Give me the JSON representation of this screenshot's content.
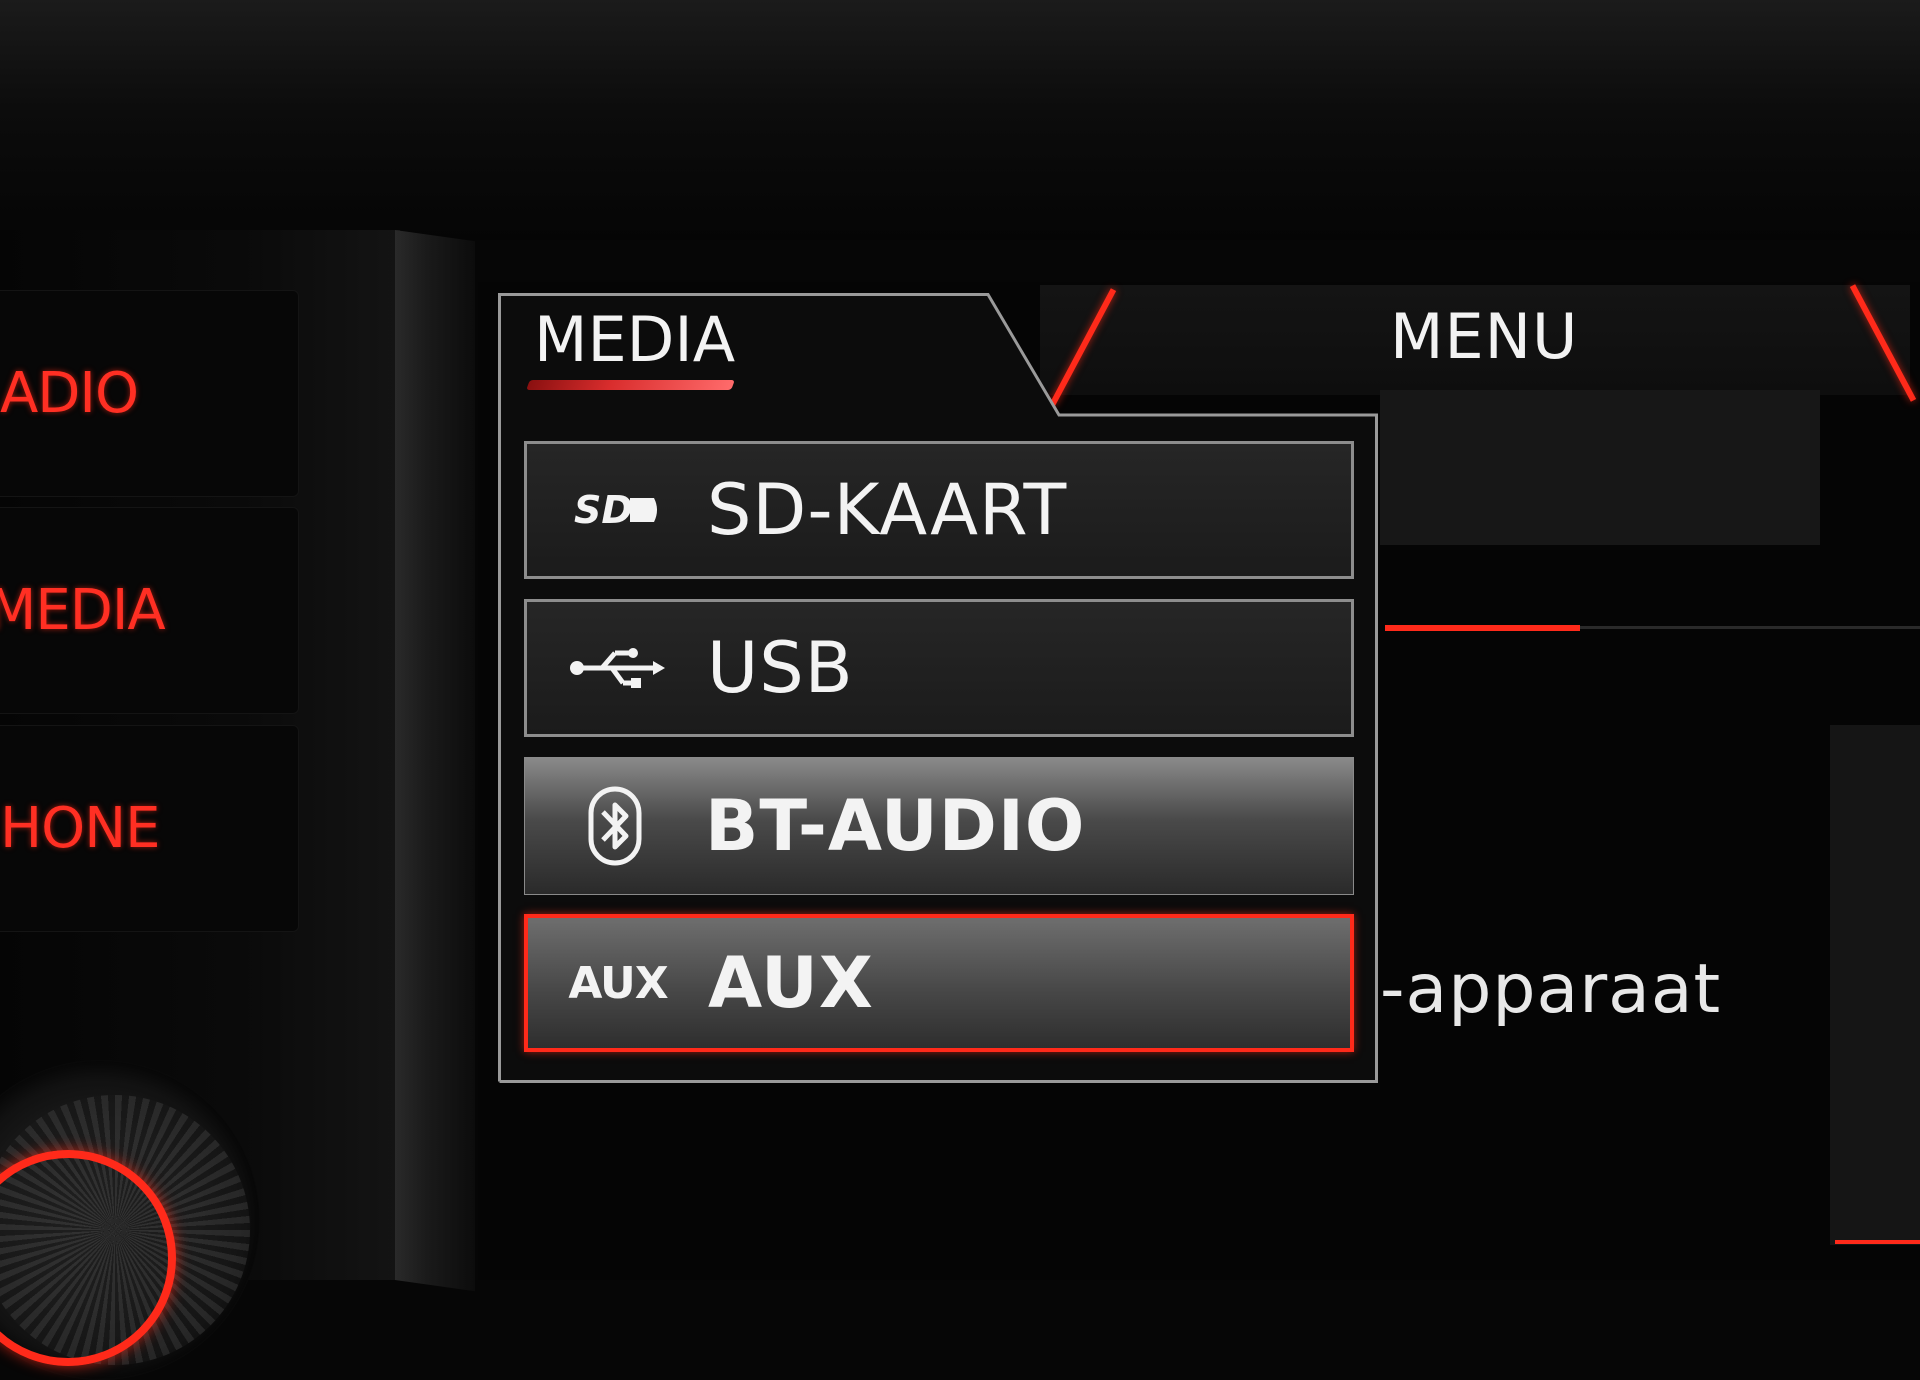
{
  "hardware_buttons": [
    {
      "label": "ADIO"
    },
    {
      "label": "MEDIA"
    },
    {
      "label": "HONE"
    }
  ],
  "header": {
    "menu_tab_label": "MENU"
  },
  "background": {
    "text": "-apparaat"
  },
  "popup": {
    "title": "MEDIA",
    "items": [
      {
        "label": "SD-KAART",
        "icon": "sd-card-icon",
        "state": "normal"
      },
      {
        "label": "USB",
        "icon": "usb-icon",
        "state": "normal"
      },
      {
        "label": "BT-AUDIO",
        "icon": "bluetooth-icon",
        "state": "highlighted"
      },
      {
        "label": "AUX",
        "icon": "aux-icon",
        "icon_text": "AUX",
        "state": "selected"
      }
    ]
  },
  "colors": {
    "accent_red": "#ff2a1a",
    "text_white": "#f3f3f3",
    "border_grey": "#8d8d8d"
  }
}
